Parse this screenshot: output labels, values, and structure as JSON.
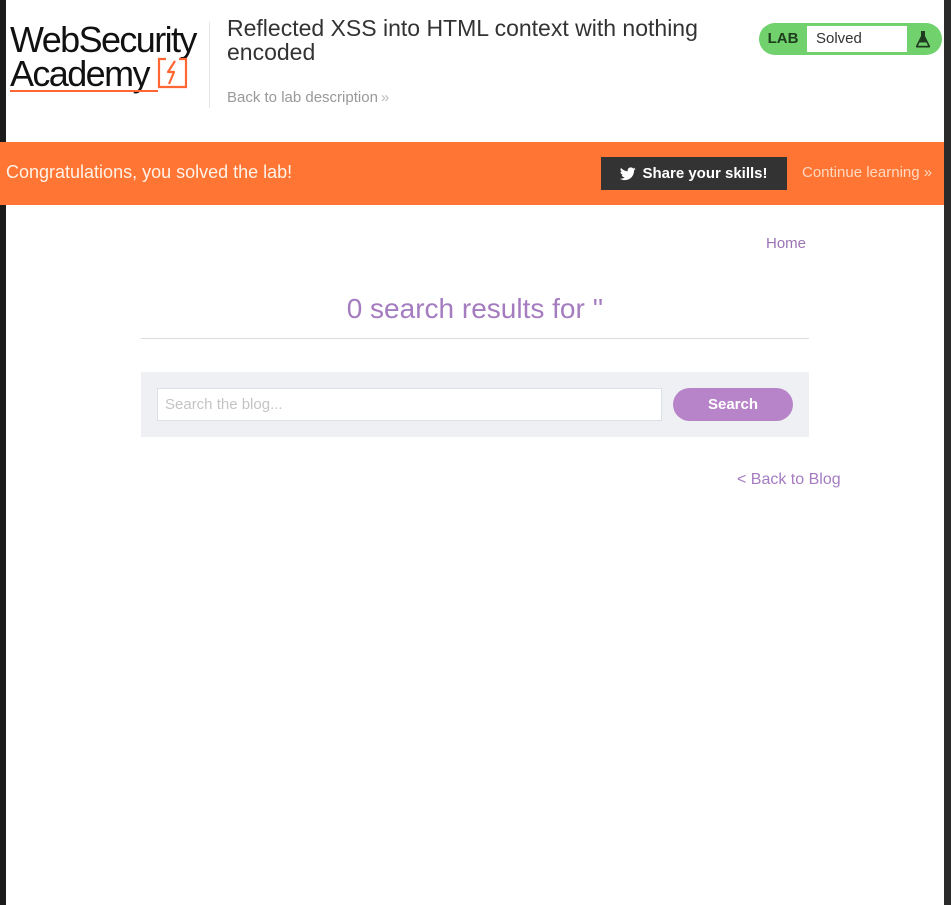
{
  "academy_header": {
    "logo": {
      "line1": "WebSecurity",
      "line2": "Academy"
    },
    "lab_title": "Reflected XSS into HTML context with nothing encoded",
    "back_link": {
      "label": "Back to lab description",
      "chevron": "»"
    },
    "lab_status": {
      "badge": "LAB",
      "value": "Solved",
      "icon": "flask-icon"
    }
  },
  "banner": {
    "message": "Congratulations, you solved the lab!",
    "share_label": "Share your skills!",
    "share_icon": "twitter-icon",
    "continue_label": "Continue learning",
    "continue_chevron": "»"
  },
  "blog": {
    "nav_home": "Home",
    "results_heading": "0 search results for ''",
    "search": {
      "placeholder": "Search the blog...",
      "value": "",
      "button": "Search"
    },
    "back_link": "< Back to Blog"
  },
  "colors": {
    "banner": "#ff7533",
    "lab_solved": "#70d16d",
    "accent_purple": "#a47cbf",
    "search_button": "#b884c9",
    "logo_accent": "#ff6633"
  }
}
